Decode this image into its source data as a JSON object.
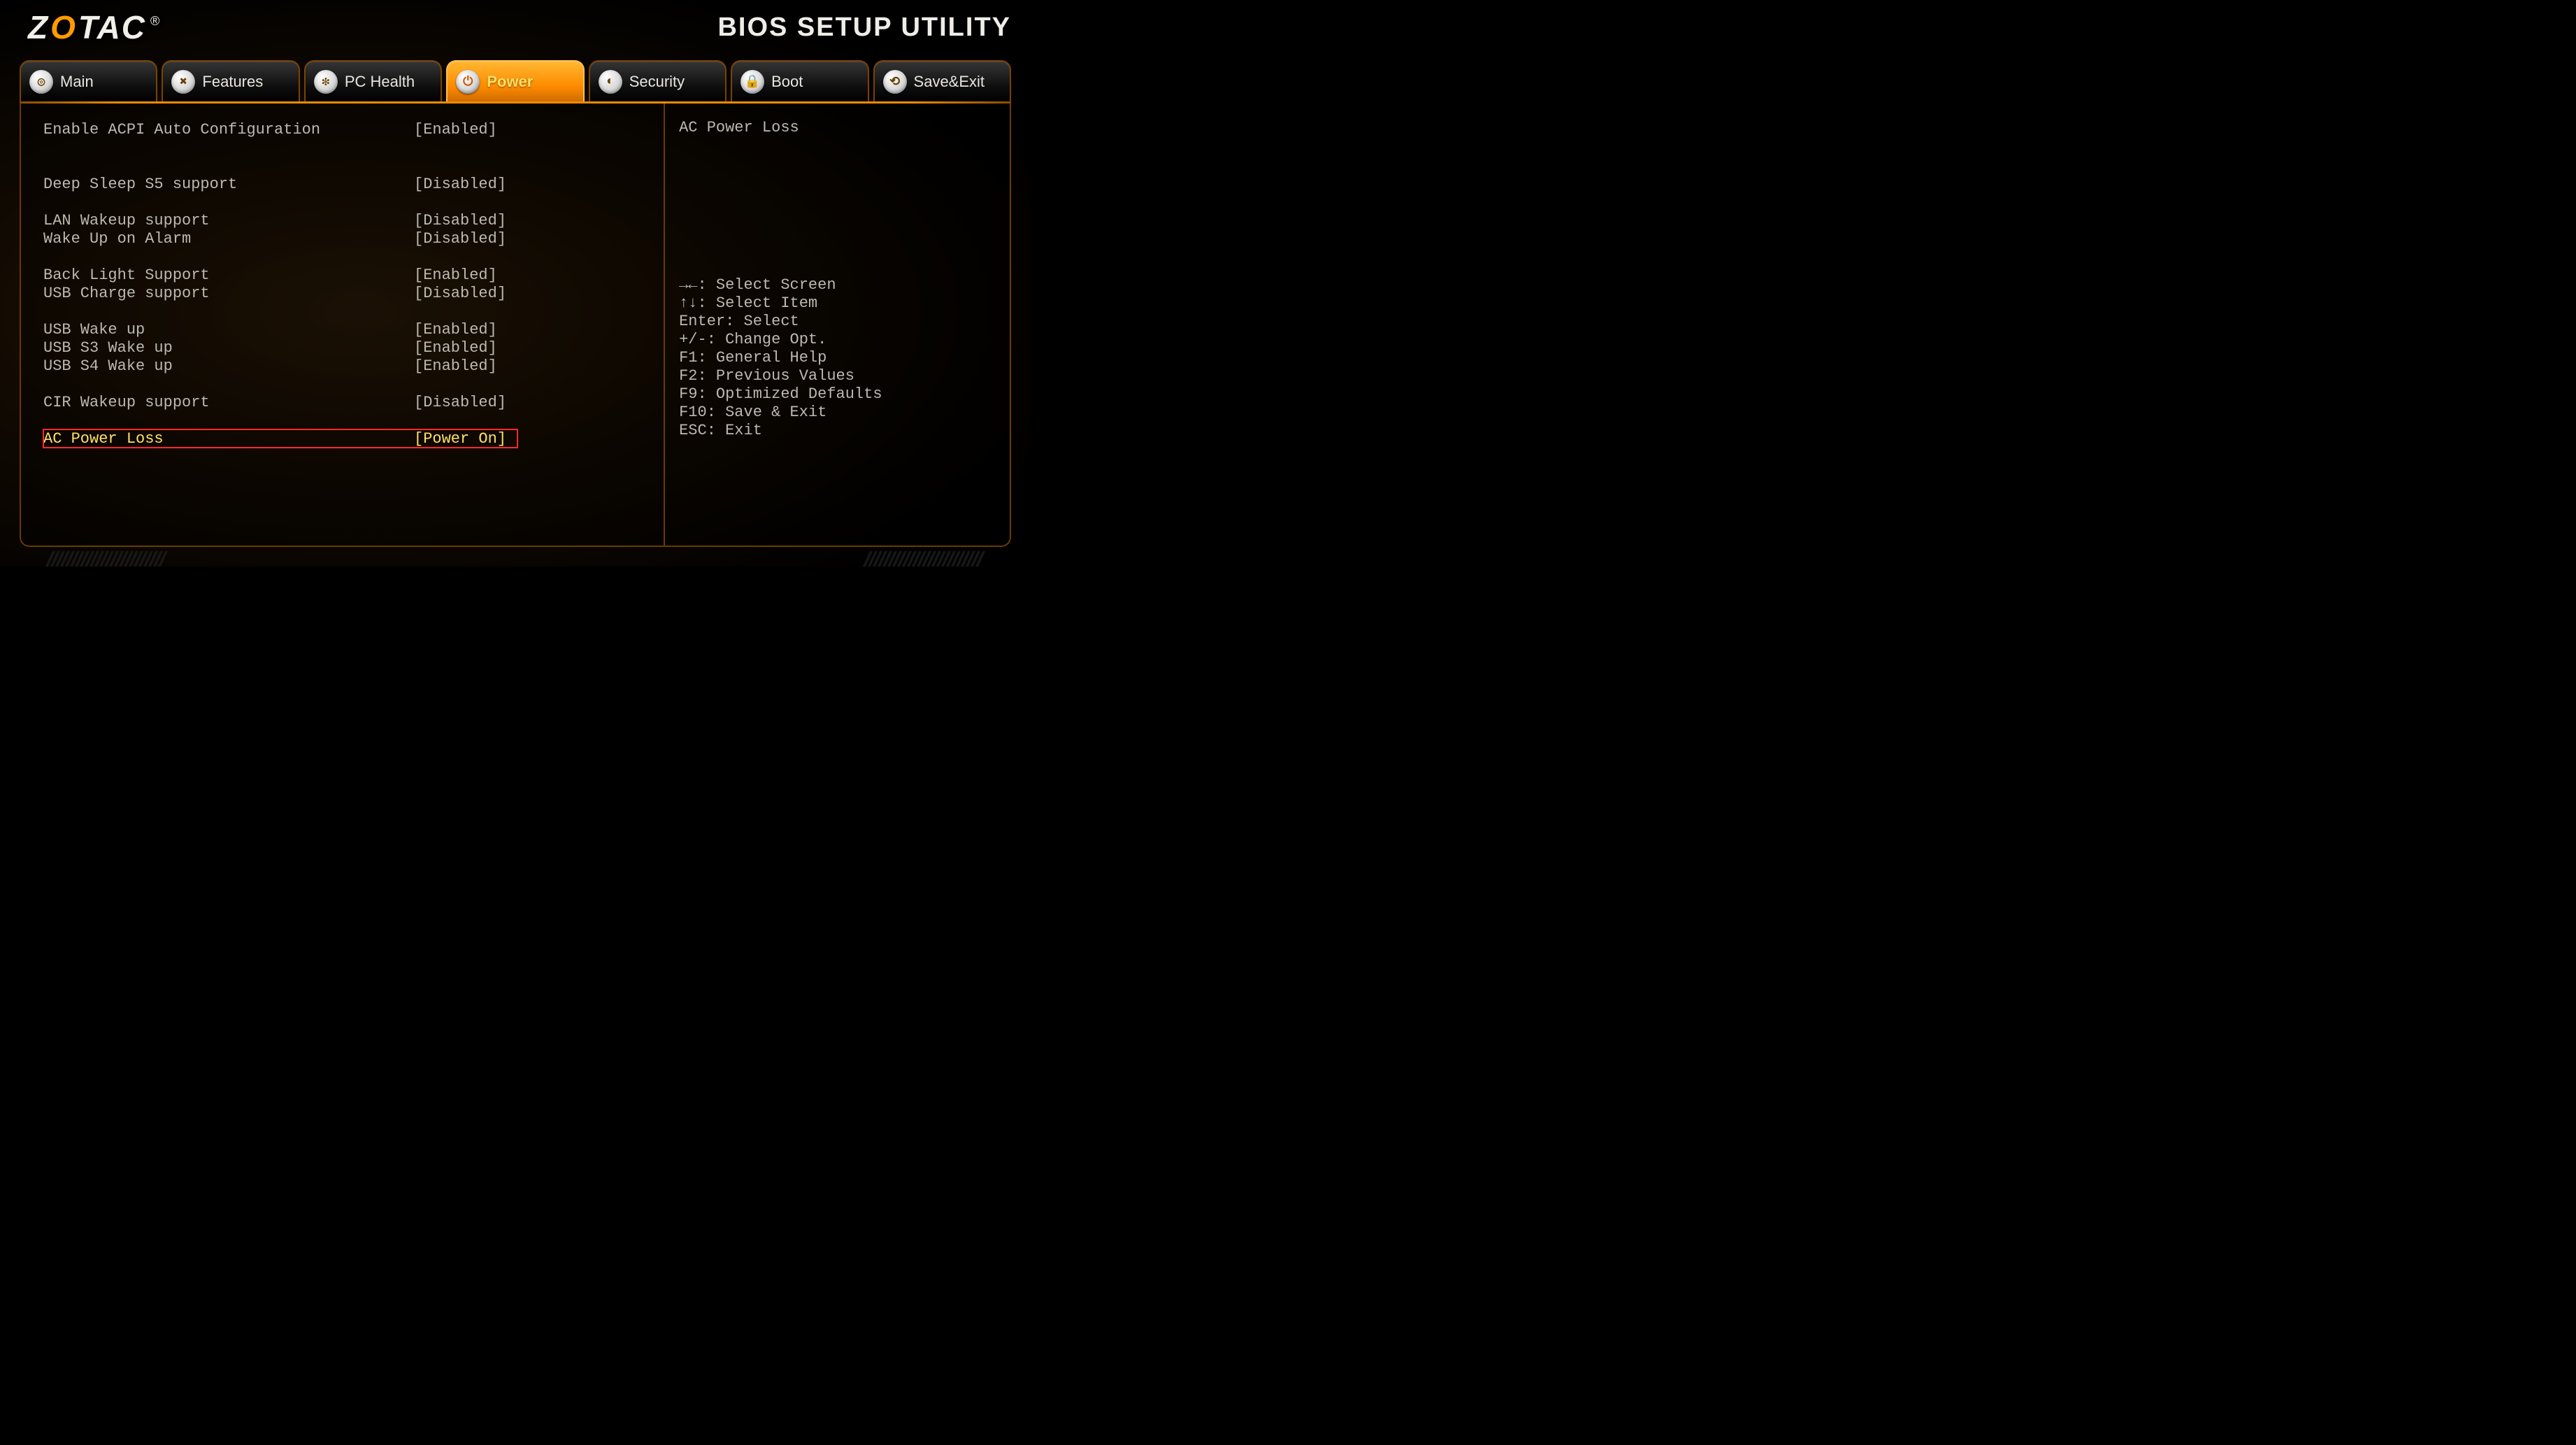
{
  "header": {
    "brand_pre": "Z",
    "brand_o": "O",
    "brand_post": "TAC",
    "brand_reg": "®",
    "title": "BIOS SETUP UTILITY"
  },
  "tabs": [
    {
      "label": "Main",
      "glyph": "◎",
      "active": false
    },
    {
      "label": "Features",
      "glyph": "✖",
      "active": false
    },
    {
      "label": "PC Health",
      "glyph": "❇",
      "active": false
    },
    {
      "label": "Power",
      "glyph": "⏻",
      "active": true
    },
    {
      "label": "Security",
      "glyph": "◐",
      "active": false
    },
    {
      "label": "Boot",
      "glyph": "🔒",
      "active": false
    },
    {
      "label": "Save&Exit",
      "glyph": "⟲",
      "active": false
    }
  ],
  "settings": [
    {
      "label": "Enable ACPI Auto Configuration",
      "value": "[Enabled]",
      "gap_after": 2,
      "selected": false
    },
    {
      "label": "Deep Sleep S5 support",
      "value": "[Disabled]",
      "gap_after": 1,
      "selected": false
    },
    {
      "label": "LAN Wakeup support",
      "value": "[Disabled]",
      "gap_after": 0,
      "selected": false
    },
    {
      "label": "Wake Up on Alarm",
      "value": "[Disabled]",
      "gap_after": 1,
      "selected": false
    },
    {
      "label": "Back Light Support",
      "value": "[Enabled]",
      "gap_after": 0,
      "selected": false
    },
    {
      "label": "USB Charge support",
      "value": "[Disabled]",
      "gap_after": 1,
      "selected": false
    },
    {
      "label": "USB Wake up",
      "value": "[Enabled]",
      "gap_after": 0,
      "selected": false
    },
    {
      "label": "USB S3 Wake up",
      "value": "[Enabled]",
      "gap_after": 0,
      "selected": false
    },
    {
      "label": "USB S4 Wake up",
      "value": "[Enabled]",
      "gap_after": 1,
      "selected": false
    },
    {
      "label": "CIR Wakeup support",
      "value": "[Disabled]",
      "gap_after": 1,
      "selected": false
    },
    {
      "label": "AC Power Loss",
      "value": "[Power On]",
      "gap_after": 0,
      "selected": true
    }
  ],
  "side": {
    "help_title": "AC Power Loss",
    "keys": [
      "→←: Select Screen",
      "↑↓: Select Item",
      "Enter: Select",
      "+/-: Change Opt.",
      "F1: General Help",
      "F2: Previous Values",
      "F9: Optimized Defaults",
      "F10: Save & Exit",
      "ESC: Exit"
    ]
  }
}
